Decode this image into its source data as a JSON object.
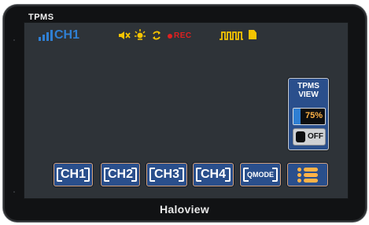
{
  "device": {
    "top_label": "TPMS",
    "brand": "Haloview"
  },
  "status_bar": {
    "signal_icon": "signal-bars-icon",
    "channel": "CH1",
    "icons": [
      "speaker-mute-icon",
      "light-icon",
      "sync-icon",
      "rec-dot-icon",
      "pulse-wave-icon",
      "document-icon"
    ],
    "rec_label": "REC",
    "colors": {
      "channel": "#2f7fd3",
      "icons": "#f5c400",
      "rec": "#e02020"
    }
  },
  "tpms_panel": {
    "title_line1": "TPMS",
    "title_line2": "VIEW",
    "level_value": "75%",
    "level_fraction": 0.75,
    "toggle_label": "OFF"
  },
  "buttons": {
    "ch1": "CH1",
    "ch2": "CH2",
    "ch3": "CH3",
    "ch4": "CH4",
    "qmode": "QMODE",
    "menu_icon": "menu-list-icon"
  },
  "theme": {
    "screen_bg": "#2e3338",
    "button_bg": "#2a4f8c",
    "button_border": "#d7a37a",
    "accent_orange": "#ffb347"
  }
}
